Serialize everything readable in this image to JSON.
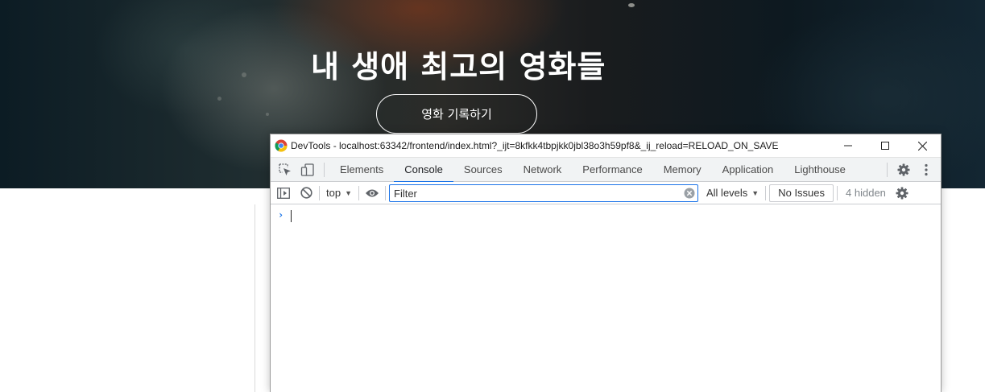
{
  "hero": {
    "title": "내 생애 최고의 영화들",
    "button_label": "영화 기록하기"
  },
  "devtools": {
    "window_title": "DevTools - localhost:63342/frontend/index.html?_ijt=8kfkk4tbpjkk0jbl38o3h59pf8&_ij_reload=RELOAD_ON_SAVE",
    "window_controls": {
      "minimize": "—",
      "maximize": "☐",
      "close": "✕"
    },
    "tabs": [
      {
        "label": "Elements"
      },
      {
        "label": "Console"
      },
      {
        "label": "Sources"
      },
      {
        "label": "Network"
      },
      {
        "label": "Performance"
      },
      {
        "label": "Memory"
      },
      {
        "label": "Application"
      },
      {
        "label": "Lighthouse"
      }
    ],
    "active_tab": "Console",
    "console_toolbar": {
      "context": "top",
      "filter_placeholder": "Filter",
      "levels": "All levels",
      "issues": "No Issues",
      "hidden": "4 hidden"
    },
    "console": {
      "prompt": "›"
    }
  },
  "colors": {
    "accent": "#1a73e8",
    "tabbar_bg": "#f1f3f4",
    "border": "#cbcdd1"
  }
}
